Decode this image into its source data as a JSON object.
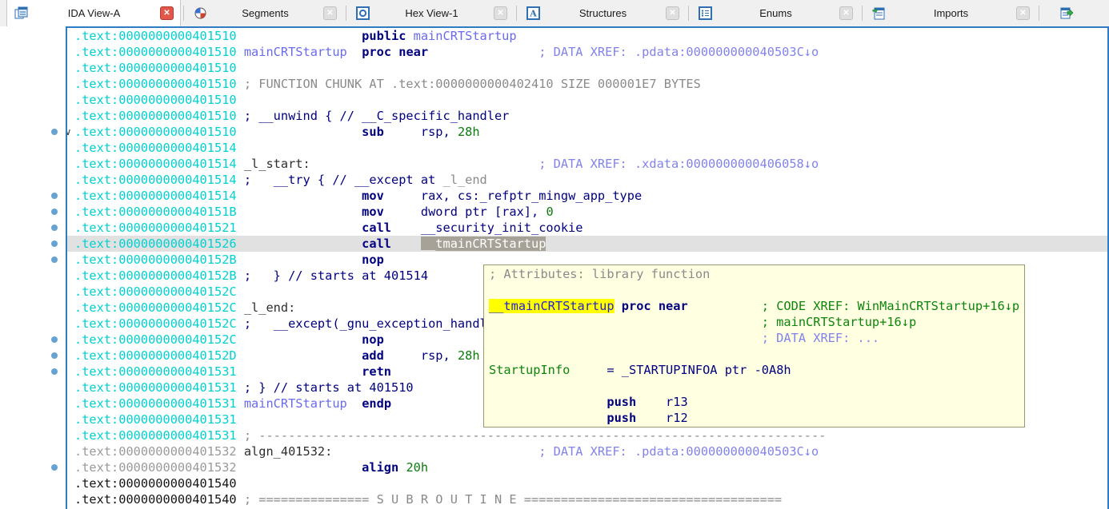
{
  "colors": {
    "focus_border": "#2e7cc4",
    "address_in_function": "#00d2d2",
    "address_gray": "#9a9a9a",
    "address_black": "#141414",
    "keyword_navy": "#000080",
    "number_green": "#0b7a0b",
    "public_name_blue": "#6a6af0",
    "xref_blue": "#8282ec",
    "comment_gray": "#8a8a8a",
    "code_xref_green": "#0d850d",
    "selected_row_bg": "#e1e1e1",
    "selected_ident_bg": "#a7a297",
    "popup_bg": "#ffffe1",
    "highlight_yellow": "#ffff00",
    "breakpoint_dot": "#66a3d2",
    "active_close_red": "#e2574a"
  },
  "icons": {
    "close_glyph": "✕",
    "chevron_glyph": "∨"
  },
  "tabs": [
    {
      "label": "IDA View-A",
      "active": true
    },
    {
      "label": "Segments",
      "active": false
    },
    {
      "label": "Hex View-1",
      "active": false
    },
    {
      "label": "Structures",
      "active": false
    },
    {
      "label": "Enums",
      "active": false
    },
    {
      "label": "Imports",
      "active": false
    },
    {
      "label": "",
      "active": false
    }
  ],
  "listing": {
    "rows": [
      {
        "dot": false,
        "chevron": false,
        "hl": false,
        "segs": [
          {
            "t": ".text:0000000000401510",
            "c": "addr"
          },
          {
            "t": "                 ",
            "c": "sp"
          },
          {
            "t": "public ",
            "c": "kw"
          },
          {
            "t": "mainCRTStartup",
            "c": "name"
          }
        ]
      },
      {
        "dot": false,
        "chevron": false,
        "hl": false,
        "segs": [
          {
            "t": ".text:0000000000401510",
            "c": "addr"
          },
          {
            "t": " ",
            "c": "sp"
          },
          {
            "t": "mainCRTStartup",
            "c": "name"
          },
          {
            "t": "  ",
            "c": "sp"
          },
          {
            "t": "proc near",
            "c": "kw"
          },
          {
            "t": "               ",
            "c": "sp"
          },
          {
            "t": "; DATA XREF: .pdata:000000000040503C↓o",
            "c": "xref"
          }
        ]
      },
      {
        "dot": false,
        "chevron": false,
        "hl": false,
        "segs": [
          {
            "t": ".text:0000000000401510",
            "c": "addr"
          }
        ]
      },
      {
        "dot": false,
        "chevron": false,
        "hl": false,
        "segs": [
          {
            "t": ".text:0000000000401510",
            "c": "addr"
          },
          {
            "t": " ",
            "c": "sp"
          },
          {
            "t": "; FUNCTION CHUNK AT .text:0000000000402410 SIZE 000001E7 BYTES",
            "c": "gray"
          }
        ]
      },
      {
        "dot": false,
        "chevron": false,
        "hl": false,
        "segs": [
          {
            "t": ".text:0000000000401510",
            "c": "addr"
          }
        ]
      },
      {
        "dot": false,
        "chevron": false,
        "hl": false,
        "segs": [
          {
            "t": ".text:0000000000401510",
            "c": "addr"
          },
          {
            "t": " ",
            "c": "sp"
          },
          {
            "t": "; __unwind { // __C_specific_handler",
            "c": "nav"
          }
        ]
      },
      {
        "dot": true,
        "chevron": true,
        "hl": false,
        "segs": [
          {
            "t": ".text:0000000000401510",
            "c": "addr"
          },
          {
            "t": "                 ",
            "c": "sp"
          },
          {
            "t": "sub",
            "c": "kw"
          },
          {
            "t": "     ",
            "c": "sp"
          },
          {
            "t": "rsp, ",
            "c": "op"
          },
          {
            "t": "28h",
            "c": "num"
          }
        ]
      },
      {
        "dot": false,
        "chevron": false,
        "hl": false,
        "segs": [
          {
            "t": ".text:0000000000401514",
            "c": "addr"
          }
        ]
      },
      {
        "dot": false,
        "chevron": false,
        "hl": false,
        "segs": [
          {
            "t": ".text:0000000000401514",
            "c": "addr"
          },
          {
            "t": " ",
            "c": "sp"
          },
          {
            "t": "_l_start:",
            "c": "lbl"
          },
          {
            "t": "                               ",
            "c": "sp"
          },
          {
            "t": "; DATA XREF: .xdata:0000000000406058↓o",
            "c": "xref"
          }
        ]
      },
      {
        "dot": false,
        "chevron": false,
        "hl": false,
        "segs": [
          {
            "t": ".text:0000000000401514",
            "c": "addr"
          },
          {
            "t": " ",
            "c": "sp"
          },
          {
            "t": ";   __try { // __except at ",
            "c": "nav"
          },
          {
            "t": "_l_end",
            "c": "gray"
          }
        ]
      },
      {
        "dot": true,
        "chevron": false,
        "hl": false,
        "segs": [
          {
            "t": ".text:0000000000401514",
            "c": "addr"
          },
          {
            "t": "                 ",
            "c": "sp"
          },
          {
            "t": "mov",
            "c": "kw"
          },
          {
            "t": "     ",
            "c": "sp"
          },
          {
            "t": "rax, cs:_refptr_mingw_app_type",
            "c": "op"
          }
        ]
      },
      {
        "dot": true,
        "chevron": false,
        "hl": false,
        "segs": [
          {
            "t": ".text:000000000040151B",
            "c": "addr"
          },
          {
            "t": "                 ",
            "c": "sp"
          },
          {
            "t": "mov",
            "c": "kw"
          },
          {
            "t": "     ",
            "c": "sp"
          },
          {
            "t": "dword ptr [rax], ",
            "c": "op"
          },
          {
            "t": "0",
            "c": "num"
          }
        ]
      },
      {
        "dot": true,
        "chevron": false,
        "hl": false,
        "segs": [
          {
            "t": ".text:0000000000401521",
            "c": "addr"
          },
          {
            "t": "                 ",
            "c": "sp"
          },
          {
            "t": "call",
            "c": "kw"
          },
          {
            "t": "    ",
            "c": "sp"
          },
          {
            "t": "__security_init_cookie",
            "c": "op"
          }
        ]
      },
      {
        "dot": true,
        "chevron": false,
        "hl": true,
        "segs": [
          {
            "t": ".text:0000000000401526",
            "c": "addr"
          },
          {
            "t": "                 ",
            "c": "sp"
          },
          {
            "t": "call",
            "c": "kw"
          },
          {
            "t": "    ",
            "c": "sp"
          },
          {
            "t": "__tmainCRTStartup",
            "c": "chip"
          }
        ]
      },
      {
        "dot": true,
        "chevron": false,
        "hl": false,
        "segs": [
          {
            "t": ".text:000000000040152B",
            "c": "addr"
          },
          {
            "t": "                 ",
            "c": "sp"
          },
          {
            "t": "nop",
            "c": "kw"
          }
        ]
      },
      {
        "dot": false,
        "chevron": false,
        "hl": false,
        "segs": [
          {
            "t": ".text:000000000040152B",
            "c": "addr"
          },
          {
            "t": " ",
            "c": "sp"
          },
          {
            "t": ";   } // starts at 401514",
            "c": "nav"
          }
        ]
      },
      {
        "dot": false,
        "chevron": false,
        "hl": false,
        "segs": [
          {
            "t": ".text:000000000040152C",
            "c": "addr"
          }
        ]
      },
      {
        "dot": false,
        "chevron": false,
        "hl": false,
        "segs": [
          {
            "t": ".text:000000000040152C",
            "c": "addr"
          },
          {
            "t": " ",
            "c": "sp"
          },
          {
            "t": "_l_end:",
            "c": "lbl"
          }
        ]
      },
      {
        "dot": false,
        "chevron": false,
        "hl": false,
        "segs": [
          {
            "t": ".text:000000000040152C",
            "c": "addr"
          },
          {
            "t": " ",
            "c": "sp"
          },
          {
            "t": ";   __except(_gnu_exception_handl",
            "c": "nav"
          }
        ]
      },
      {
        "dot": true,
        "chevron": false,
        "hl": false,
        "segs": [
          {
            "t": ".text:000000000040152C",
            "c": "addr"
          },
          {
            "t": "                 ",
            "c": "sp"
          },
          {
            "t": "nop",
            "c": "kw"
          }
        ]
      },
      {
        "dot": true,
        "chevron": false,
        "hl": false,
        "segs": [
          {
            "t": ".text:000000000040152D",
            "c": "addr"
          },
          {
            "t": "                 ",
            "c": "sp"
          },
          {
            "t": "add",
            "c": "kw"
          },
          {
            "t": "     ",
            "c": "sp"
          },
          {
            "t": "rsp, ",
            "c": "op"
          },
          {
            "t": "28h",
            "c": "num"
          }
        ]
      },
      {
        "dot": true,
        "chevron": false,
        "hl": false,
        "segs": [
          {
            "t": ".text:0000000000401531",
            "c": "addr"
          },
          {
            "t": "                 ",
            "c": "sp"
          },
          {
            "t": "retn",
            "c": "kw"
          }
        ]
      },
      {
        "dot": false,
        "chevron": false,
        "hl": false,
        "segs": [
          {
            "t": ".text:0000000000401531",
            "c": "addr"
          },
          {
            "t": " ",
            "c": "sp"
          },
          {
            "t": "; } // starts at 401510",
            "c": "nav"
          }
        ]
      },
      {
        "dot": false,
        "chevron": false,
        "hl": false,
        "segs": [
          {
            "t": ".text:0000000000401531",
            "c": "addr"
          },
          {
            "t": " ",
            "c": "sp"
          },
          {
            "t": "mainCRTStartup",
            "c": "name"
          },
          {
            "t": "  ",
            "c": "sp"
          },
          {
            "t": "endp",
            "c": "kw"
          }
        ]
      },
      {
        "dot": false,
        "chevron": false,
        "hl": false,
        "segs": [
          {
            "t": ".text:0000000000401531",
            "c": "addr"
          }
        ]
      },
      {
        "dot": false,
        "chevron": false,
        "hl": false,
        "segs": [
          {
            "t": ".text:0000000000401531",
            "c": "addr"
          },
          {
            "t": " ",
            "c": "sp"
          },
          {
            "t": "; -----------------------------------------------------------------------------",
            "c": "gray"
          }
        ]
      },
      {
        "dot": false,
        "chevron": false,
        "hl": false,
        "segs": [
          {
            "t": ".text:0000000000401532",
            "c": "addrg"
          },
          {
            "t": " ",
            "c": "sp"
          },
          {
            "t": "algn_401532:",
            "c": "lbl"
          },
          {
            "t": "                            ",
            "c": "sp"
          },
          {
            "t": "; DATA XREF: .pdata:000000000040503C↓o",
            "c": "xref"
          }
        ]
      },
      {
        "dot": true,
        "chevron": false,
        "hl": false,
        "segs": [
          {
            "t": ".text:0000000000401532",
            "c": "addrg"
          },
          {
            "t": "                 ",
            "c": "sp"
          },
          {
            "t": "align ",
            "c": "kw"
          },
          {
            "t": "20h",
            "c": "num"
          }
        ]
      },
      {
        "dot": false,
        "chevron": false,
        "hl": false,
        "segs": [
          {
            "t": ".text:0000000000401540",
            "c": "addrk"
          }
        ]
      },
      {
        "dot": false,
        "chevron": false,
        "hl": false,
        "segs": [
          {
            "t": ".text:0000000000401540",
            "c": "addrk"
          },
          {
            "t": " ",
            "c": "sp"
          },
          {
            "t": "; =============== S U B R O U T I N E ===================================",
            "c": "gray"
          }
        ]
      }
    ]
  },
  "popup": {
    "rows": [
      {
        "segs": [
          {
            "t": "; Attributes: library function",
            "c": "gray"
          }
        ]
      },
      {
        "segs": []
      },
      {
        "segs": [
          {
            "t": "__tmainCRTStartup",
            "c": "hl"
          },
          {
            "t": " ",
            "c": "sp"
          },
          {
            "t": "proc near",
            "c": "kw"
          },
          {
            "t": "          ",
            "c": "sp"
          },
          {
            "t": "; CODE XREF: WinMainCRTStartup+16↓p",
            "c": "grn"
          }
        ]
      },
      {
        "segs": [
          {
            "t": "                                     ",
            "c": "sp"
          },
          {
            "t": "; mainCRTStartup+16↓p",
            "c": "grn"
          }
        ]
      },
      {
        "segs": [
          {
            "t": "                                     ",
            "c": "sp"
          },
          {
            "t": "; DATA XREF: ...",
            "c": "xref"
          }
        ]
      },
      {
        "segs": []
      },
      {
        "segs": [
          {
            "t": "StartupInfo",
            "c": "grn"
          },
          {
            "t": "     ",
            "c": "sp"
          },
          {
            "t": "= _STARTUPINFOA ptr -0A8h",
            "c": "op"
          }
        ]
      },
      {
        "segs": []
      },
      {
        "segs": [
          {
            "t": "                ",
            "c": "sp"
          },
          {
            "t": "push",
            "c": "kw"
          },
          {
            "t": "    ",
            "c": "sp"
          },
          {
            "t": "r13",
            "c": "op"
          }
        ]
      },
      {
        "segs": [
          {
            "t": "                ",
            "c": "sp"
          },
          {
            "t": "push",
            "c": "kw"
          },
          {
            "t": "    ",
            "c": "sp"
          },
          {
            "t": "r12",
            "c": "op"
          }
        ]
      }
    ]
  }
}
